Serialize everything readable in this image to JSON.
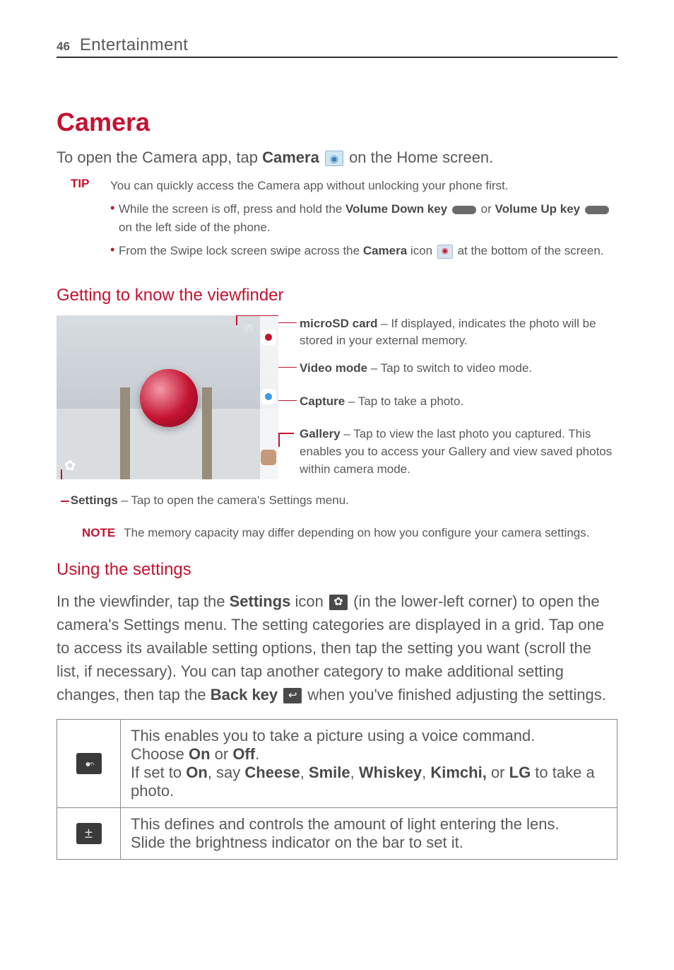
{
  "page": {
    "number": "46",
    "section": "Entertainment"
  },
  "h1": "Camera",
  "intro": {
    "pre": "To open the Camera app, tap ",
    "bold": "Camera",
    "post": " on the Home screen."
  },
  "tip": {
    "label": "TIP",
    "lead": "You can quickly access the Camera app without unlocking your phone first.",
    "bullets": [
      {
        "pre": "While the screen is off, press and hold the ",
        "b1": "Volume Down key",
        "mid": " or ",
        "b2": "Volume Up key",
        "post": " on the left side of the phone."
      },
      {
        "pre": "From the Swipe lock screen swipe across the ",
        "b1": "Camera",
        "mid": " icon ",
        "post": " at the bottom of the screen."
      }
    ]
  },
  "h2_viewfinder": "Getting to know the viewfinder",
  "annotations": {
    "sd": {
      "name": "microSD card",
      "text": " – If displayed, indicates the photo will be stored in your external memory."
    },
    "video": {
      "name": "Video mode",
      "text": " – Tap to switch to video mode."
    },
    "capture": {
      "name": "Capture",
      "text": " – Tap to take a photo."
    },
    "gallery": {
      "name": "Gallery",
      "text": " – Tap to view the last photo you captured. This enables you to access your Gallery and view saved photos within camera mode."
    },
    "settings": {
      "name": "Settings",
      "text": " – Tap to open the camera's Settings menu."
    }
  },
  "note": {
    "label": "NOTE",
    "text": "The memory capacity may differ depending on how you configure your camera settings."
  },
  "h2_settings": "Using the settings",
  "settings_para": {
    "p1a": "In the viewfinder, tap the ",
    "p1b": "Settings",
    "p1c": " icon ",
    "p1d": " (in the lower-left corner) to open the camera's Settings menu. The setting categories are displayed in a grid. Tap one to access its available setting options, then tap the setting you want (scroll the list, if necessary). You can tap another category to make additional setting changes, then tap the ",
    "p1e": "Back key",
    "p1f": " when you've finished adjusting the settings."
  },
  "table": [
    {
      "icon": "voice",
      "l1": "This enables you to take a picture using a voice command.",
      "l2a": "Choose ",
      "l2b": "On",
      "l2c": " or ",
      "l2d": "Off",
      "l2e": ".",
      "l3a": "If set to ",
      "l3b": "On",
      "l3c": ", say ",
      "l3d": "Cheese",
      "l3e": ", ",
      "l3f": "Smile",
      "l3g": ", ",
      "l3h": "Whiskey",
      "l3i": ", ",
      "l3j": "Kimchi,",
      "l3k": " or ",
      "l3l": "LG",
      "l3m": " to take a photo."
    },
    {
      "icon": "brightness",
      "l1": "This defines and controls the amount of light entering the lens.",
      "l2": "Slide the brightness indicator on the bar to set it."
    }
  ]
}
